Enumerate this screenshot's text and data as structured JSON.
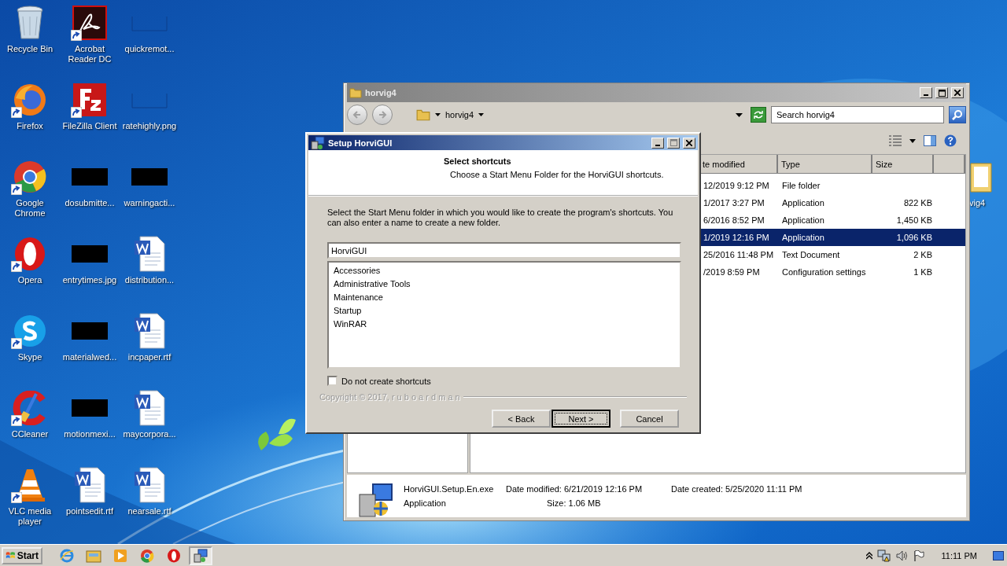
{
  "desktop": {
    "icons": [
      {
        "label": "Recycle Bin",
        "kind": "recycle",
        "shortcut": false
      },
      {
        "label": "Firefox",
        "kind": "firefox",
        "shortcut": true
      },
      {
        "label": "Google Chrome",
        "kind": "chrome",
        "shortcut": true
      },
      {
        "label": "Opera",
        "kind": "opera",
        "shortcut": true
      },
      {
        "label": "Skype",
        "kind": "skype",
        "shortcut": true
      },
      {
        "label": "CCleaner",
        "kind": "ccleaner",
        "shortcut": true
      },
      {
        "label": "VLC media player",
        "kind": "vlc",
        "shortcut": true
      },
      {
        "label": "Acrobat Reader DC",
        "kind": "acrobat",
        "shortcut": true
      },
      {
        "label": "FileZilla Client",
        "kind": "filezilla",
        "shortcut": true
      },
      {
        "label": "dosubmitte...",
        "kind": "redacted",
        "shortcut": false
      },
      {
        "label": "entrytimes.jpg",
        "kind": "redacted",
        "shortcut": false
      },
      {
        "label": "materialwed...",
        "kind": "redacted",
        "shortcut": false
      },
      {
        "label": "motionmexi...",
        "kind": "redacted",
        "shortcut": false
      },
      {
        "label": "pointsedit.rtf",
        "kind": "word",
        "shortcut": false
      },
      {
        "label": "quickremot...",
        "kind": "blank",
        "shortcut": false
      },
      {
        "label": "ratehighly.png",
        "kind": "blank",
        "shortcut": false
      },
      {
        "label": "warningacti...",
        "kind": "redacted",
        "shortcut": false
      },
      {
        "label": "distribution...",
        "kind": "word",
        "shortcut": false
      },
      {
        "label": "incpaper.rtf",
        "kind": "word",
        "shortcut": false
      },
      {
        "label": "maycorpora...",
        "kind": "word",
        "shortcut": false
      },
      {
        "label": "nearsale.rtf",
        "kind": "word",
        "shortcut": false
      }
    ],
    "covered_icon": {
      "label": "vig4"
    }
  },
  "explorer": {
    "title": "horvig4",
    "breadcrumb": "horvig4",
    "search": {
      "placeholder": "Search horvig4"
    },
    "columns": [
      "te modified",
      "Type",
      "Size"
    ],
    "rows": [
      {
        "date": "12/2019 9:12 PM",
        "type": "File folder",
        "selected": false
      },
      {
        "date": "1/2017 3:27 PM",
        "type": "Application",
        "size": "822 KB",
        "selected": false
      },
      {
        "date": "6/2016 8:52 PM",
        "type": "Application",
        "size": "1,450 KB",
        "selected": false
      },
      {
        "date": "1/2019 12:16 PM",
        "type": "Application",
        "size": "1,096 KB",
        "selected": true
      },
      {
        "date": "25/2016 11:48 PM",
        "type": "Text Document",
        "size": "2 KB",
        "selected": false
      },
      {
        "date": "/2019 8:59 PM",
        "type": "Configuration settings",
        "size": "1 KB",
        "selected": false
      }
    ],
    "details": {
      "name": "HorviGUI.Setup.En.exe",
      "type": "Application",
      "modified": "Date modified: 6/21/2019 12:16 PM",
      "size": "Size: 1.06 MB",
      "created": "Date created: 5/25/2020 11:11 PM"
    }
  },
  "dialog": {
    "title": "Setup HorviGUI",
    "heading": "Select shortcuts",
    "subheading": "Choose a Start Menu Folder for the HorviGUI shortcuts.",
    "instructions": "Select the Start Menu folder in which you would like to create the program's shortcuts. You can also enter a name to create a new folder.",
    "folder_field": {
      "value": "HorviGUI"
    },
    "folders": [
      {
        "label": "Accessories",
        "selected": false
      },
      {
        "label": "Administrative Tools",
        "selected": false
      },
      {
        "label": "Maintenance",
        "selected": false
      },
      {
        "label": "Startup",
        "selected": false
      },
      {
        "label": "WinRAR",
        "selected": false
      }
    ],
    "no_shortcuts": {
      "label": "Do not create shortcuts",
      "checked": false
    },
    "copyright": "Copyright © 2017, r u b o a r d m a n",
    "buttons": [
      {
        "label": "< Back",
        "default": false
      },
      {
        "label": "Next >",
        "default": true
      },
      {
        "label": "Cancel",
        "default": false
      }
    ]
  },
  "taskbar": {
    "start": "Start",
    "apps": [
      {
        "kind": "ie",
        "active": false
      },
      {
        "kind": "folder",
        "active": false
      },
      {
        "kind": "media",
        "active": false
      },
      {
        "kind": "chrome",
        "active": false
      },
      {
        "kind": "opera",
        "active": false
      },
      {
        "kind": "setup",
        "active": true
      }
    ],
    "clock": "11:11 PM"
  }
}
